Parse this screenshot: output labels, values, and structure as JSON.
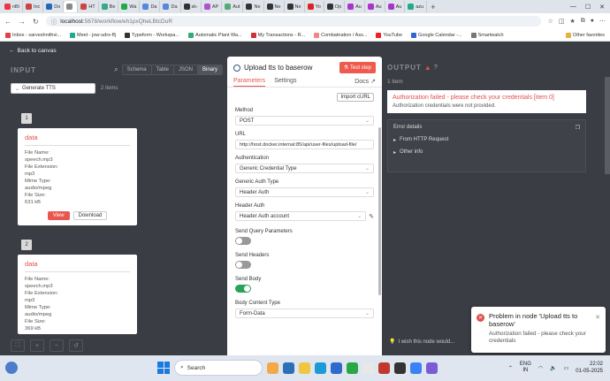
{
  "browser": {
    "tabs": [
      {
        "label": "nBi"
      },
      {
        "label": "Inc"
      },
      {
        "label": "Do"
      },
      {
        "label": ""
      },
      {
        "label": "HT"
      },
      {
        "label": "Be"
      },
      {
        "label": "Wa"
      },
      {
        "label": "Da"
      },
      {
        "label": "Da"
      },
      {
        "label": "sk-"
      },
      {
        "label": "AP"
      },
      {
        "label": "Aut"
      },
      {
        "label": "Ne"
      },
      {
        "label": "Ne"
      },
      {
        "label": "Ne"
      },
      {
        "label": "Yo"
      },
      {
        "label": "Op"
      },
      {
        "label": "Au"
      },
      {
        "label": "Au"
      },
      {
        "label": "Au"
      },
      {
        "label": "azu"
      }
    ],
    "url_host": "localhost",
    "url_path": ":5678/workflow/eh1pxQheLBtcDuR",
    "bookmarks": [
      "Inbox - sarveshnithvi...",
      "Meet - jow-udrx-ffj",
      "Typeform - Workspa...",
      "Automatic Plant Wa...",
      "My Transactions - R...",
      "Combatnation / Ass...",
      "YouTube",
      "Google Calendar -...",
      "Smartwatch"
    ],
    "other_favorites": "Other favorites"
  },
  "app": {
    "back_label": "Back to canvas",
    "input": {
      "title": "INPUT",
      "view_tabs": [
        "Schema",
        "Table",
        "JSON",
        "Binary"
      ],
      "node_name": "Generate TTS",
      "items_count": "2 items",
      "items": [
        {
          "index": "1",
          "title": "data",
          "file_name_label": "File Name:",
          "file_name": "speech.mp3",
          "file_ext_label": "File Extension:",
          "file_ext": "mp3",
          "mime_label": "Mime Type:",
          "mime": "audio/mpeg",
          "size_label": "File Size:",
          "size": "631 kB",
          "view_label": "View",
          "download_label": "Download"
        },
        {
          "index": "2",
          "title": "data",
          "file_name_label": "File Name:",
          "file_name": "speech.mp3",
          "file_ext_label": "File Extension:",
          "file_ext": "mp3",
          "mime_label": "Mime Type:",
          "mime": "audio/mpeg",
          "size_label": "File Size:",
          "size": "369 kB"
        }
      ]
    },
    "node": {
      "title": "Upload tts to baserow",
      "test_step": "Test step",
      "tabs": [
        "Parameters",
        "Settings"
      ],
      "docs": "Docs",
      "import_curl": "Import cURL",
      "method_label": "Method",
      "method": "POST",
      "url_label": "URL",
      "url": "http://host.docker.internal:85/api/user-files/upload-file/",
      "auth_label": "Authentication",
      "auth": "Generic Credential Type",
      "generic_auth_label": "Generic Auth Type",
      "generic_auth": "Header Auth",
      "header_auth_label": "Header Auth",
      "header_auth": "Header Auth account",
      "send_query_label": "Send Query Parameters",
      "send_headers_label": "Send Headers",
      "send_body_label": "Send Body",
      "body_type_label": "Body Content Type",
      "body_type": "Form-Data"
    },
    "output": {
      "title": "OUTPUT",
      "count": "1 item",
      "error_title": "Authorization failed - please check your credentials [item 0]",
      "error_sub": "Authorization credentials were not provided.",
      "details_label": "Error details",
      "detail_rows": [
        "From HTTP Request",
        "Other info"
      ]
    },
    "wish": "I wish this node would..."
  },
  "toast": {
    "title": "Problem in node 'Upload tts to baserow'",
    "message": "Authorization failed - please check your credentials"
  },
  "taskbar": {
    "search_placeholder": "Search",
    "lang_top": "ENG",
    "lang_bottom": "IN",
    "time": "22:02",
    "date": "01-05-2025"
  }
}
